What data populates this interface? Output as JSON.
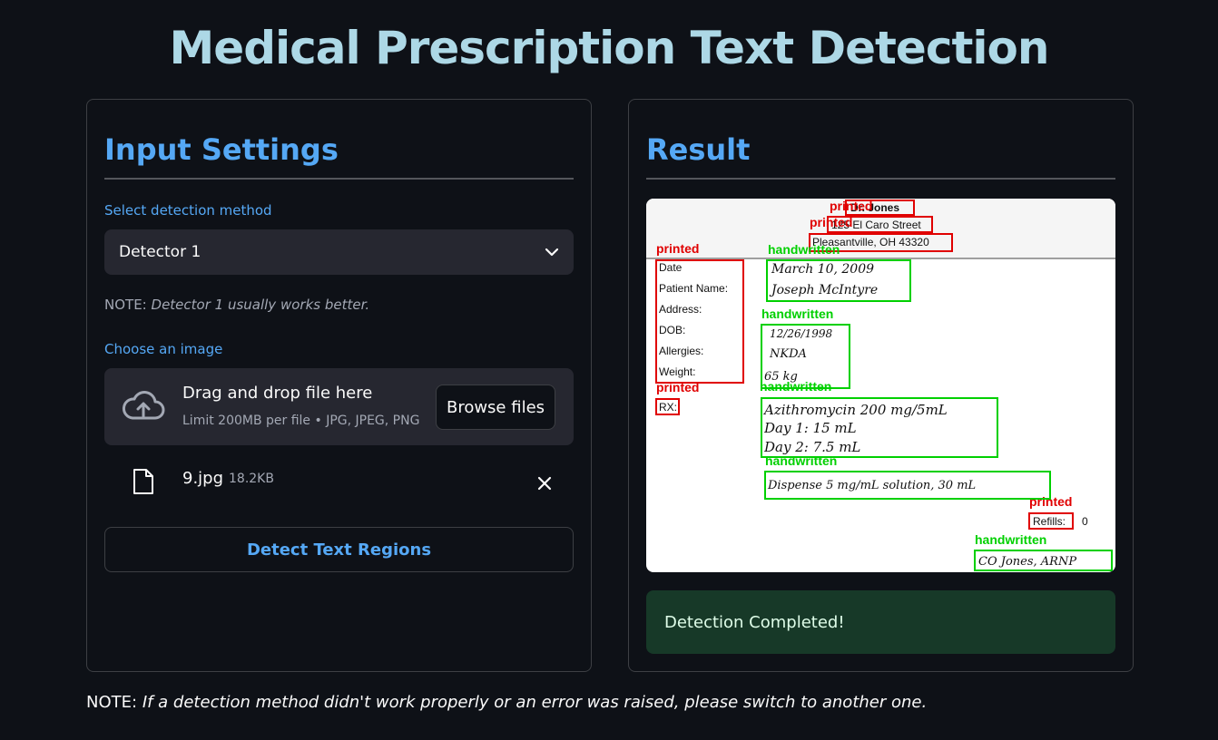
{
  "app": {
    "title": "Medical Prescription Text Detection"
  },
  "input_panel": {
    "heading": "Input Settings",
    "method_label": "Select detection method",
    "method_value": "Detector 1",
    "note_prefix": "NOTE:",
    "note_text": "Detector 1 usually works better.",
    "image_label": "Choose an image",
    "dropzone_main": "Drag and drop file here",
    "dropzone_sub": "Limit 200MB per file • JPG, JPEG, PNG",
    "browse_label": "Browse files",
    "file_name": "9.jpg",
    "file_size": "18.2KB",
    "detect_label": "Detect Text Regions"
  },
  "result_panel": {
    "heading": "Result",
    "success_text": "Detection Completed!",
    "prescription": {
      "header_lines": [
        "Dr. Jones",
        "125 El Caro Street",
        "Pleasantville, OH 43320"
      ],
      "field_labels": [
        "Date",
        "Patient Name:",
        "Address:",
        "DOB:",
        "Allergies:",
        "Weight:"
      ],
      "date_value": "March 10, 2009",
      "patient_value": "Joseph McIntyre",
      "dob_value": "12/26/1998",
      "allergies_value": "NKDA",
      "weight_value": "65 kg",
      "rx_label": "RX:",
      "rx_lines": [
        "Azithromycin 200 mg/5mL",
        "Day 1:  15 mL",
        "Day 2:  7.5 mL"
      ],
      "dispense_line": "Dispense 5 mg/mL solution, 30 mL",
      "refills_label": "Refills:",
      "refills_value": "0",
      "signature": "CO Jones, ARNP"
    },
    "detection_tags": {
      "printed": "printed",
      "handwritten": "handwritten"
    },
    "colors": {
      "printed": "#ff0000",
      "handwritten": "#00e000"
    }
  },
  "footer": {
    "prefix": "NOTE:",
    "text": "If a detection method didn't work properly or an error was raised, please switch to another one."
  },
  "colors": {
    "background": "#0e1117",
    "title": "#add8e6",
    "accent": "#55a8f5",
    "success_bg": "#173928"
  }
}
